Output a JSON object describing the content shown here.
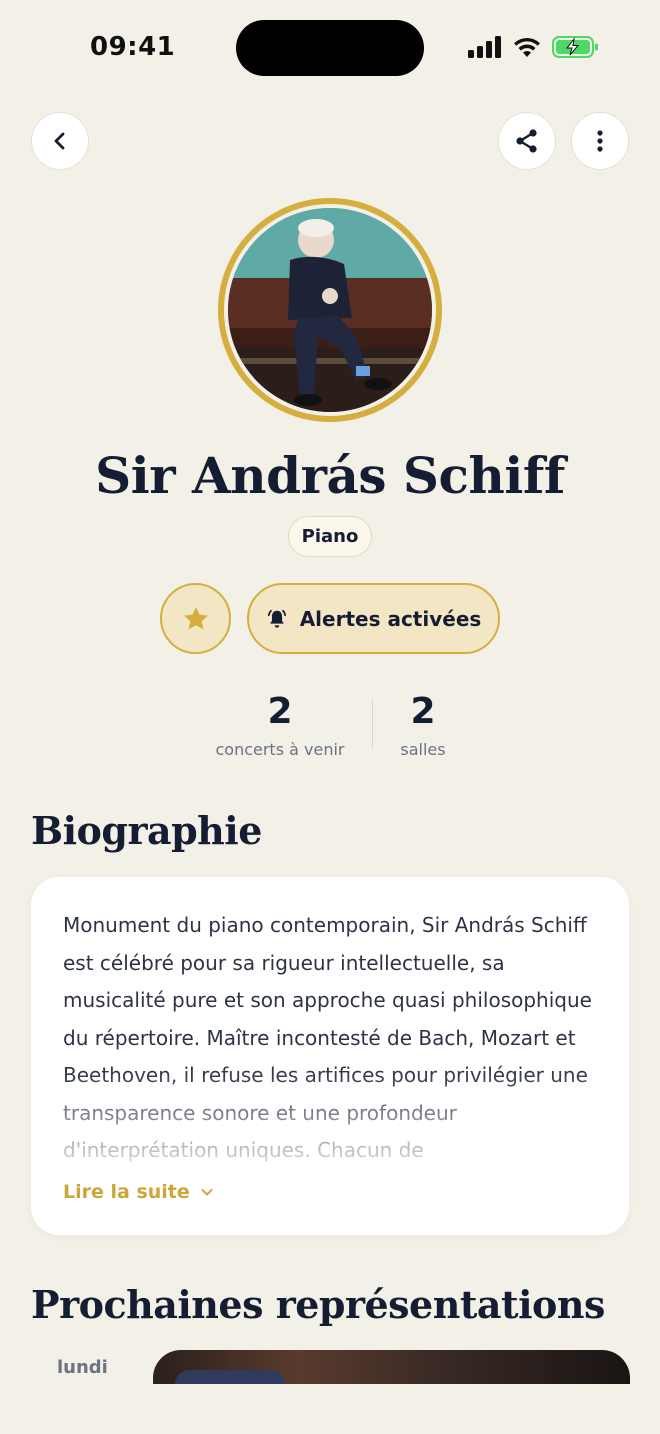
{
  "status_bar": {
    "time": "09:41"
  },
  "navigation": {
    "back_icon": "chevron-left-icon",
    "share_icon": "share-icon",
    "more_icon": "more-vertical-icon"
  },
  "artist": {
    "name": "Sir András Schiff",
    "instrument": "Piano",
    "alert_label": "Alertes activées",
    "stats": [
      {
        "value": "2",
        "label": "concerts à venir"
      },
      {
        "value": "2",
        "label": "salles"
      }
    ]
  },
  "biography": {
    "title": "Biographie",
    "text": "Monument du piano contemporain, Sir András Schiff est célébré pour sa rigueur intellectuelle, sa musicalité pure et son approche quasi philosophique du répertoire. Maître incontesté de Bach, Mozart et Beethoven, il refuse les artifices pour privilégier une transparence sonore et une profondeur d'interprétation uniques. Chacun de",
    "read_more": "Lire la suite"
  },
  "upcoming": {
    "title": "Prochaines représentations",
    "day_label": "lundi"
  },
  "colors": {
    "background": "#F3F0E8",
    "accent_gold": "#D4AE3E",
    "text_dark": "#151D33",
    "battery_green": "#4CD964"
  }
}
